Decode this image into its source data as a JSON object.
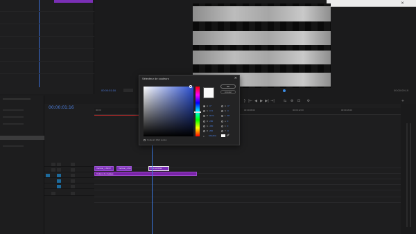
{
  "program": {
    "timecode": "00:00:01:16",
    "fit": "Ajuster",
    "duration": "00:00:09:19",
    "close_glyph": "×"
  },
  "timeline": {
    "timecode": "00:00:01:16",
    "ruler_ticks": [
      "00:00",
      "00:00:04:00",
      "00:00:08:00",
      "00:00:12:00",
      "00:00:16:00"
    ],
    "clips": [
      {
        "label": "Vertical_1.MOV"
      },
      {
        "label": "Vertical_2.MOV"
      },
      {
        "label": "Titre vertical"
      }
    ],
    "adjustment_clip": "Calque de réglage"
  },
  "color_picker": {
    "title": "Sélecteur de couleurs",
    "ok": "OK",
    "cancel": "Annuler",
    "hsb": [
      {
        "label": "H",
        "value": "0 °"
      },
      {
        "label": "S",
        "value": "0 %"
      },
      {
        "label": "B",
        "value": "98 %"
      },
      {
        "label": "R",
        "value": "250"
      },
      {
        "label": "G",
        "value": "250"
      },
      {
        "label": "B",
        "value": "250"
      }
    ],
    "lab": [
      {
        "label": "H",
        "value": "0 °"
      },
      {
        "label": "S",
        "value": "0"
      },
      {
        "label": "L",
        "value": "98"
      },
      {
        "label": "a",
        "value": "0"
      },
      {
        "label": "b",
        "value": "0"
      },
      {
        "label": "Y",
        "value": "0"
      }
    ],
    "hex_label": "#",
    "hex_value": "FAFAFA",
    "web_only": "Couleurs Web seules",
    "eyedropper_glyph": "✐",
    "close_glyph": "×",
    "selected_color": "#FAFAFA"
  },
  "transport": {
    "icons": [
      "{",
      "}",
      "|←",
      "◀",
      "▶",
      "▶|",
      "→|",
      "⇆",
      "⊕",
      "⊡",
      "⚙",
      "+"
    ]
  }
}
